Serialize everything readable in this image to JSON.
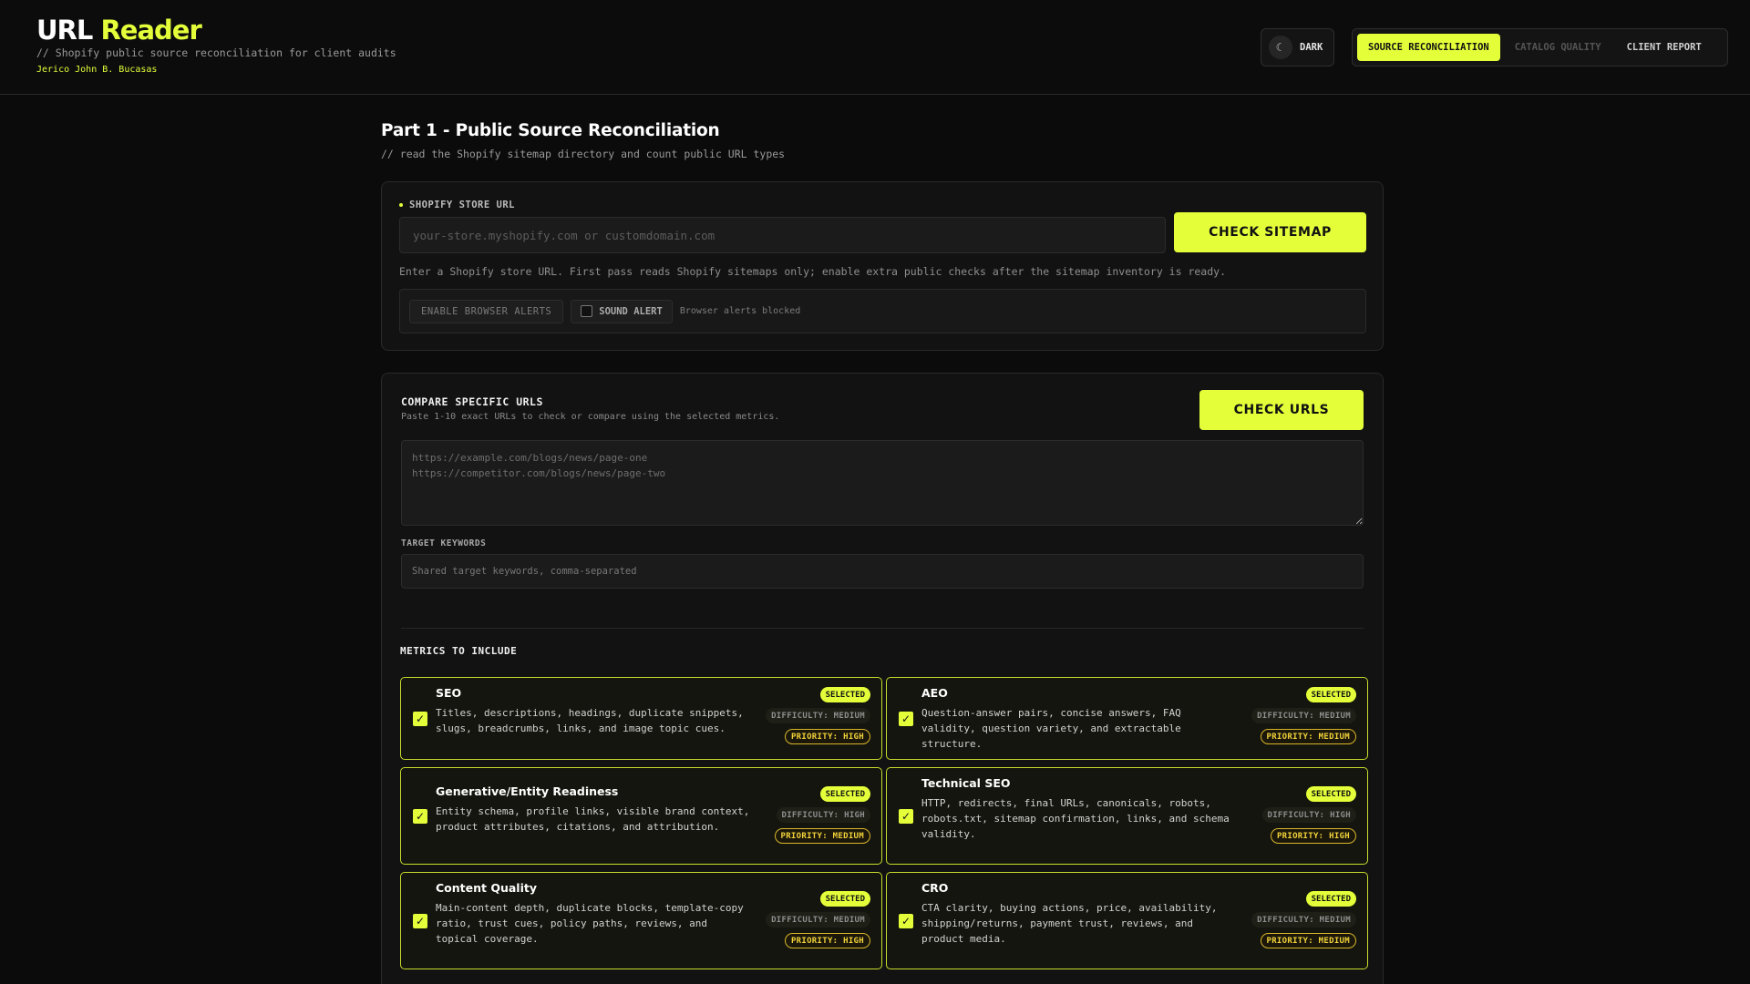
{
  "header": {
    "logo_part1": "URL",
    "logo_part2": "Reader",
    "tagline": "// Shopify public source reconciliation for client audits",
    "author": "Jerico John B. Bucasas",
    "theme_icon": "moon-icon",
    "theme_label": "DARK",
    "tabs": [
      {
        "label": "SOURCE RECONCILIATION",
        "state": "active"
      },
      {
        "label": "CATALOG QUALITY",
        "state": "disabled"
      },
      {
        "label": "CLIENT REPORT",
        "state": "normal"
      }
    ]
  },
  "page": {
    "title": "Part 1 - Public Source Reconciliation",
    "subtitle": "// read the Shopify sitemap directory and count public URL types"
  },
  "store_card": {
    "label": "SHOPIFY STORE URL",
    "input_placeholder": "your-store.myshopify.com or customdomain.com",
    "input_value": "",
    "button": "CHECK SITEMAP",
    "hint": "Enter a Shopify store URL. First pass reads Shopify sitemaps only; enable extra public checks after the sitemap inventory is ready.",
    "alerts_button": "ENABLE BROWSER ALERTS",
    "sound_label": "SOUND ALERT",
    "sound_checked": false,
    "alert_status": "Browser alerts blocked"
  },
  "compare_card": {
    "title": "COMPARE SPECIFIC URLS",
    "subtitle": "Paste 1-10 exact URLs to check or compare using the selected metrics.",
    "button": "CHECK URLS",
    "urls_placeholder": "https://example.com/blogs/news/page-one\nhttps://competitor.com/blogs/news/page-two",
    "keywords_label": "TARGET KEYWORDS",
    "keywords_placeholder": "Shared target keywords, comma-separated",
    "metrics_title": "METRICS TO INCLUDE",
    "metrics": [
      {
        "title": "SEO",
        "desc": "Titles, descriptions, headings, duplicate snippets, slugs, breadcrumbs, links, and image topic cues.",
        "selected": "SELECTED",
        "difficulty": "DIFFICULTY: MEDIUM",
        "priority": "PRIORITY: HIGH",
        "checked": true
      },
      {
        "title": "AEO",
        "desc": "Question-answer pairs, concise answers, FAQ validity, question variety, and extractable structure.",
        "selected": "SELECTED",
        "difficulty": "DIFFICULTY: MEDIUM",
        "priority": "PRIORITY: MEDIUM",
        "checked": true
      },
      {
        "title": "Generative/Entity Readiness",
        "desc": "Entity schema, profile links, visible brand context, product attributes, citations, and attribution.",
        "selected": "SELECTED",
        "difficulty": "DIFFICULTY: HIGH",
        "priority": "PRIORITY: MEDIUM",
        "checked": true
      },
      {
        "title": "Technical SEO",
        "desc": "HTTP, redirects, final URLs, canonicals, robots, robots.txt, sitemap confirmation, links, and schema validity.",
        "selected": "SELECTED",
        "difficulty": "DIFFICULTY: HIGH",
        "priority": "PRIORITY: HIGH",
        "checked": true
      },
      {
        "title": "Content Quality",
        "desc": "Main-content depth, duplicate blocks, template-copy ratio, trust cues, policy paths, reviews, and topical coverage.",
        "selected": "SELECTED",
        "difficulty": "DIFFICULTY: MEDIUM",
        "priority": "PRIORITY: HIGH",
        "checked": true
      },
      {
        "title": "CRO",
        "desc": "CTA clarity, buying actions, price, availability, shipping/returns, payment trust, reviews, and product media.",
        "selected": "SELECTED",
        "difficulty": "DIFFICULTY: MEDIUM",
        "priority": "PRIORITY: MEDIUM",
        "checked": true
      }
    ]
  },
  "colors": {
    "accent": "#e4ff3a",
    "background": "#0b0b0b",
    "priority": "#f2d23a"
  }
}
